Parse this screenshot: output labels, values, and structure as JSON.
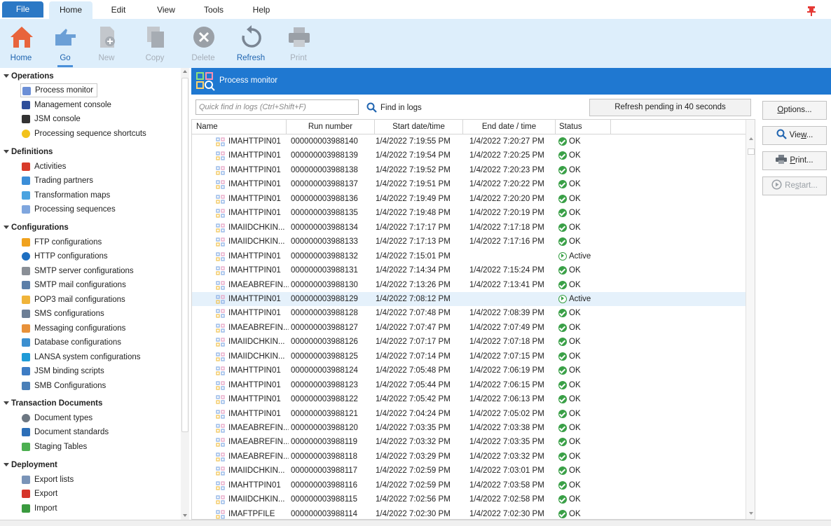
{
  "menu": {
    "file": "File",
    "home": "Home",
    "edit": "Edit",
    "view": "View",
    "tools": "Tools",
    "help": "Help"
  },
  "ribbon": {
    "home": "Home",
    "go": "Go",
    "new": "New",
    "copy": "Copy",
    "delete": "Delete",
    "refresh": "Refresh",
    "print": "Print"
  },
  "sidebar": {
    "groups": [
      {
        "label": "Operations",
        "items": [
          "Process monitor",
          "Management console",
          "JSM console",
          "Processing sequence shortcuts"
        ]
      },
      {
        "label": "Definitions",
        "items": [
          "Activities",
          "Trading partners",
          "Transformation maps",
          "Processing sequences"
        ]
      },
      {
        "label": "Configurations",
        "items": [
          "FTP configurations",
          "HTTP configurations",
          "SMTP server configurations",
          "SMTP mail configurations",
          "POP3 mail configurations",
          "SMS configurations",
          "Messaging configurations",
          "Database configurations",
          "LANSA system configurations",
          "JSM binding scripts",
          "SMB Configurations"
        ]
      },
      {
        "label": "Transaction Documents",
        "items": [
          "Document types",
          "Document standards",
          "Staging Tables"
        ]
      },
      {
        "label": "Deployment",
        "items": [
          "Export lists",
          "Export",
          "Import"
        ]
      }
    ]
  },
  "process_monitor": {
    "title": "Process monitor",
    "search_placeholder": "Quick find in logs (Ctrl+Shift+F)",
    "find_label": "Find in logs",
    "refresh_pending": "Refresh pending in 40 seconds",
    "buttons": {
      "options_u": "O",
      "options_rest": "ptions...",
      "view_a": "Vie",
      "view_u": "w",
      "view_b": "...",
      "print_u": "P",
      "print_rest": "rint...",
      "restart_a": "Re",
      "restart_u": "s",
      "restart_b": "tart..."
    },
    "columns": [
      "Name",
      "Run number",
      "Start date/time",
      "End date / time",
      "Status"
    ],
    "rows": [
      [
        "IMAHTTPIN01",
        "000000003988140",
        "1/4/2022 7:19:55 PM",
        "1/4/2022 7:20:27 PM",
        "OK"
      ],
      [
        "IMAHTTPIN01",
        "000000003988139",
        "1/4/2022 7:19:54 PM",
        "1/4/2022 7:20:25 PM",
        "OK"
      ],
      [
        "IMAHTTPIN01",
        "000000003988138",
        "1/4/2022 7:19:52 PM",
        "1/4/2022 7:20:23 PM",
        "OK"
      ],
      [
        "IMAHTTPIN01",
        "000000003988137",
        "1/4/2022 7:19:51 PM",
        "1/4/2022 7:20:22 PM",
        "OK"
      ],
      [
        "IMAHTTPIN01",
        "000000003988136",
        "1/4/2022 7:19:49 PM",
        "1/4/2022 7:20:20 PM",
        "OK"
      ],
      [
        "IMAHTTPIN01",
        "000000003988135",
        "1/4/2022 7:19:48 PM",
        "1/4/2022 7:20:19 PM",
        "OK"
      ],
      [
        "IMAIIDCHKIN...",
        "000000003988134",
        "1/4/2022 7:17:17 PM",
        "1/4/2022 7:17:18 PM",
        "OK"
      ],
      [
        "IMAIIDCHKIN...",
        "000000003988133",
        "1/4/2022 7:17:13 PM",
        "1/4/2022 7:17:16 PM",
        "OK"
      ],
      [
        "IMAHTTPIN01",
        "000000003988132",
        "1/4/2022 7:15:01 PM",
        "",
        "Active"
      ],
      [
        "IMAHTTPIN01",
        "000000003988131",
        "1/4/2022 7:14:34 PM",
        "1/4/2022 7:15:24 PM",
        "OK"
      ],
      [
        "IMAEABREFIN...",
        "000000003988130",
        "1/4/2022 7:13:26 PM",
        "1/4/2022 7:13:41 PM",
        "OK"
      ],
      [
        "IMAHTTPIN01",
        "000000003988129",
        "1/4/2022 7:08:12 PM",
        "",
        "Active"
      ],
      [
        "IMAHTTPIN01",
        "000000003988128",
        "1/4/2022 7:07:48 PM",
        "1/4/2022 7:08:39 PM",
        "OK"
      ],
      [
        "IMAEABREFIN...",
        "000000003988127",
        "1/4/2022 7:07:47 PM",
        "1/4/2022 7:07:49 PM",
        "OK"
      ],
      [
        "IMAIIDCHKIN...",
        "000000003988126",
        "1/4/2022 7:07:17 PM",
        "1/4/2022 7:07:18 PM",
        "OK"
      ],
      [
        "IMAIIDCHKIN...",
        "000000003988125",
        "1/4/2022 7:07:14 PM",
        "1/4/2022 7:07:15 PM",
        "OK"
      ],
      [
        "IMAHTTPIN01",
        "000000003988124",
        "1/4/2022 7:05:48 PM",
        "1/4/2022 7:06:19 PM",
        "OK"
      ],
      [
        "IMAHTTPIN01",
        "000000003988123",
        "1/4/2022 7:05:44 PM",
        "1/4/2022 7:06:15 PM",
        "OK"
      ],
      [
        "IMAHTTPIN01",
        "000000003988122",
        "1/4/2022 7:05:42 PM",
        "1/4/2022 7:06:13 PM",
        "OK"
      ],
      [
        "IMAHTTPIN01",
        "000000003988121",
        "1/4/2022 7:04:24 PM",
        "1/4/2022 7:05:02 PM",
        "OK"
      ],
      [
        "IMAEABREFIN...",
        "000000003988120",
        "1/4/2022 7:03:35 PM",
        "1/4/2022 7:03:38 PM",
        "OK"
      ],
      [
        "IMAEABREFIN...",
        "000000003988119",
        "1/4/2022 7:03:32 PM",
        "1/4/2022 7:03:35 PM",
        "OK"
      ],
      [
        "IMAEABREFIN...",
        "000000003988118",
        "1/4/2022 7:03:29 PM",
        "1/4/2022 7:03:32 PM",
        "OK"
      ],
      [
        "IMAIIDCHKIN...",
        "000000003988117",
        "1/4/2022 7:02:59 PM",
        "1/4/2022 7:03:01 PM",
        "OK"
      ],
      [
        "IMAHTTPIN01",
        "000000003988116",
        "1/4/2022 7:02:59 PM",
        "1/4/2022 7:03:58 PM",
        "OK"
      ],
      [
        "IMAIIDCHKIN...",
        "000000003988115",
        "1/4/2022 7:02:56 PM",
        "1/4/2022 7:02:58 PM",
        "OK"
      ],
      [
        "IMAFTPFILE",
        "000000003988114",
        "1/4/2022 7:02:30 PM",
        "1/4/2022 7:02:30 PM",
        "OK"
      ]
    ]
  }
}
